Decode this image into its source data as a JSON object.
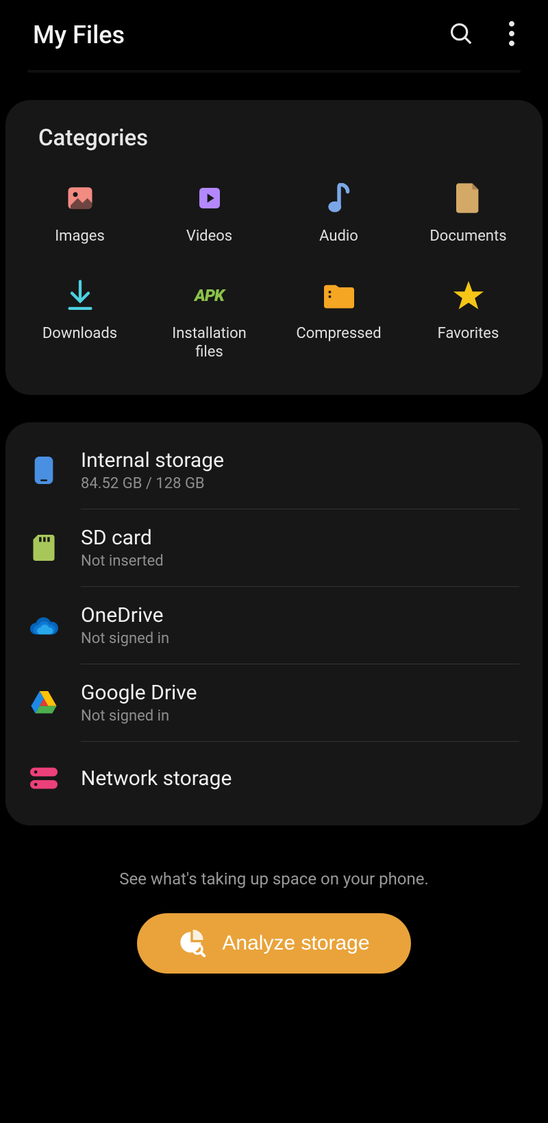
{
  "header": {
    "title": "My Files"
  },
  "categories": {
    "title": "Categories",
    "items": [
      {
        "label": "Images"
      },
      {
        "label": "Videos"
      },
      {
        "label": "Audio"
      },
      {
        "label": "Documents"
      },
      {
        "label": "Downloads"
      },
      {
        "label": "Installation\nfiles"
      },
      {
        "label": "Compressed"
      },
      {
        "label": "Favorites"
      }
    ]
  },
  "storage": {
    "items": [
      {
        "title": "Internal storage",
        "sub": "84.52 GB / 128 GB"
      },
      {
        "title": "SD card",
        "sub": "Not inserted"
      },
      {
        "title": "OneDrive",
        "sub": "Not signed in"
      },
      {
        "title": "Google Drive",
        "sub": "Not signed in"
      },
      {
        "title": "Network storage",
        "sub": ""
      }
    ]
  },
  "footer": {
    "hint": "See what's taking up space on your phone.",
    "button": "Analyze storage"
  }
}
